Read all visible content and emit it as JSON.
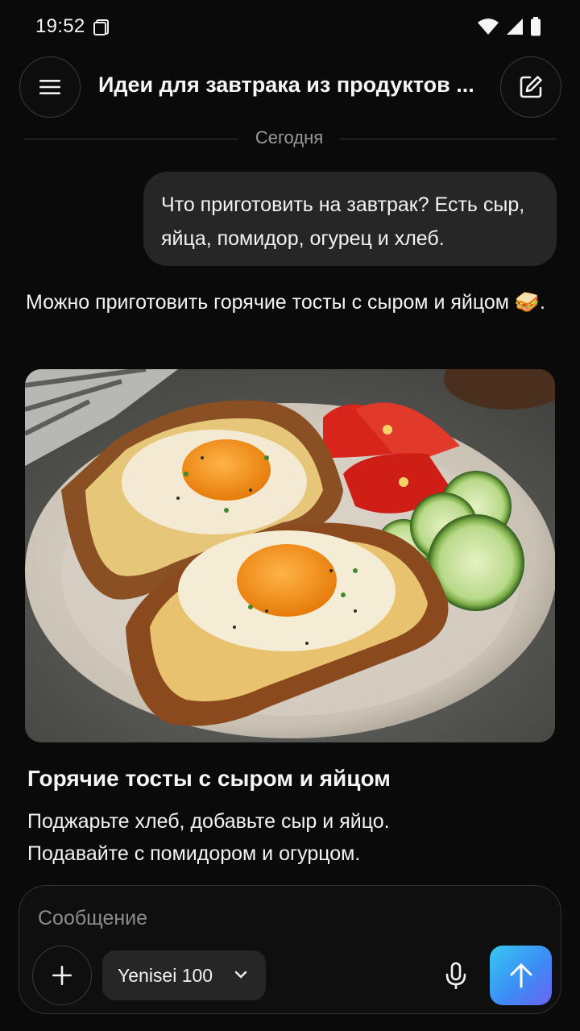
{
  "status_bar": {
    "time": "19:52"
  },
  "header": {
    "title": "Идеи для завтрака из продуктов ..."
  },
  "chat": {
    "date_divider": "Сегодня",
    "user_message": "Что приготовить на завтрак? Есть сыр, яйца, помидор, огурец и хлеб.",
    "assistant_message": "Можно приготовить горячие тосты с сыром и яйцом 🥪.",
    "recipe_title": "Горячие тосты с сыром и яйцом",
    "recipe_line1": "Поджарьте хлеб, добавьте сыр и яйцо.",
    "recipe_line2": "Подавайте с помидором и огурцом."
  },
  "composer": {
    "placeholder": "Сообщение",
    "model": "Yenisei 100"
  },
  "icons": {
    "menu": "menu-icon",
    "edit": "edit-icon",
    "plus": "plus-icon",
    "mic": "microphone-icon",
    "send": "arrow-up-icon",
    "chevron": "chevron-down-icon"
  },
  "colors": {
    "background": "#0a0a0a",
    "bubble": "#262626",
    "send_gradient_start": "#36c9f2",
    "send_gradient_end": "#6a63f5"
  }
}
